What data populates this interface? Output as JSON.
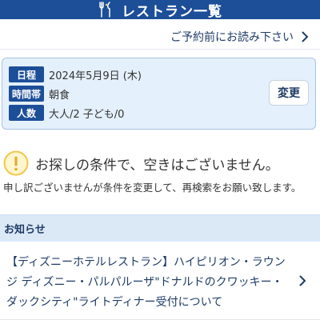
{
  "header": {
    "title": "レストラン一覧",
    "icon": "cutlery-icon"
  },
  "notice_link": {
    "label": "ご予約前にお読み下さい",
    "icon": "chevron-right-icon"
  },
  "criteria": {
    "rows": [
      {
        "label": "日程",
        "value": "2024年5月9日 (木)"
      },
      {
        "label": "時間帯",
        "value": "朝食"
      },
      {
        "label": "人数",
        "value": "大人/2 子ども/0"
      }
    ],
    "change_label": "変更"
  },
  "result": {
    "icon": "warning-icon",
    "message": "お探しの条件で、空きはございません。"
  },
  "apology": "申し訳ございませんが条件を変更して、再検索をお願い致します。",
  "news": {
    "title": "お知らせ",
    "items": [
      {
        "text": "【ディズニーホテルレストラン】ハイピリオン・ラウンジ ディズニー・パルパルーザ\"ドナルドのクワッキー・ダックシティ\"ライトディナー受付について"
      }
    ]
  },
  "colors": {
    "brand": "#1d4e98",
    "panel": "#e4f0fb",
    "news_header": "#dbe9f6",
    "warning": "#f2c84b"
  }
}
